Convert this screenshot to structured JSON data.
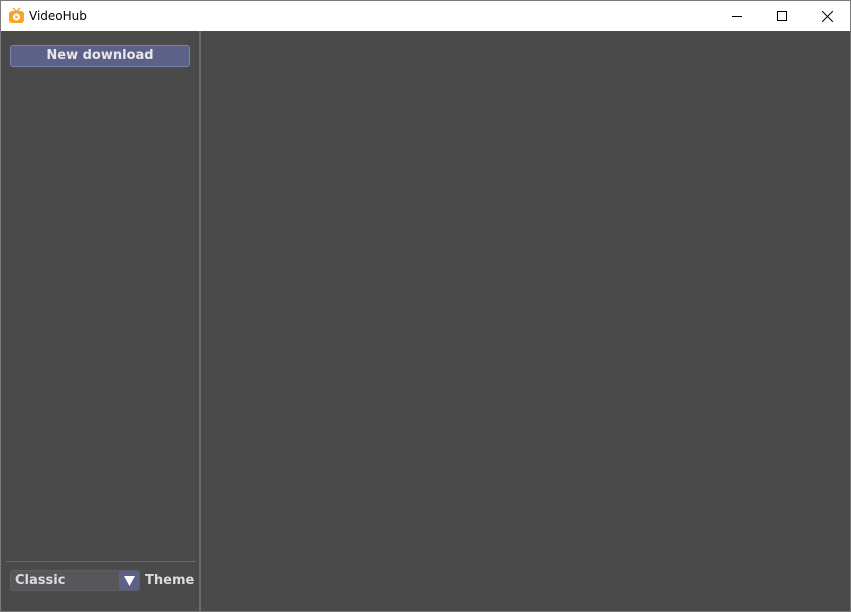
{
  "window": {
    "title": "VideoHub",
    "icon": "tv-play-icon",
    "controls": {
      "minimize": "minimize-icon",
      "maximize": "maximize-icon",
      "close": "close-icon"
    }
  },
  "sidebar": {
    "new_download_label": "New download",
    "theme": {
      "selected": "Classic",
      "label": "Theme"
    }
  },
  "colors": {
    "background": "#4a4a4a",
    "accent": "#5c6287",
    "app_icon": "#f5a623"
  }
}
